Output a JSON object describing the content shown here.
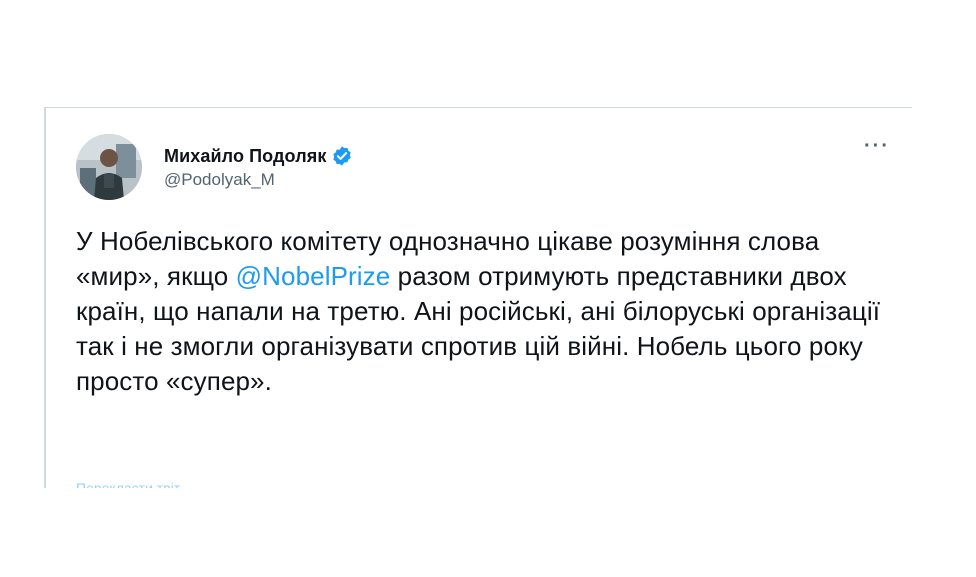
{
  "tweet": {
    "author": {
      "display_name": "Михайло Подоляк",
      "handle": "@Podolyak_M",
      "verified_icon": "verified-badge-icon",
      "verified_color": "#1d9bf0"
    },
    "more_label": "···",
    "text_before_mention": "У Нобелівського комітету однозначно цікаве розуміння слова «мир», якщо ",
    "mention": "@NobelPrize",
    "text_after_mention": " разом отримують представники двох країн, що напали на третю. Ані російські, ані білоруські організації так і не змогли організувати спротив цій війні. Нобель цього року просто «супер».",
    "translate_label": "Перекласти твіт",
    "mention_color": "#1d9bf0",
    "text_color": "#0f1419"
  }
}
